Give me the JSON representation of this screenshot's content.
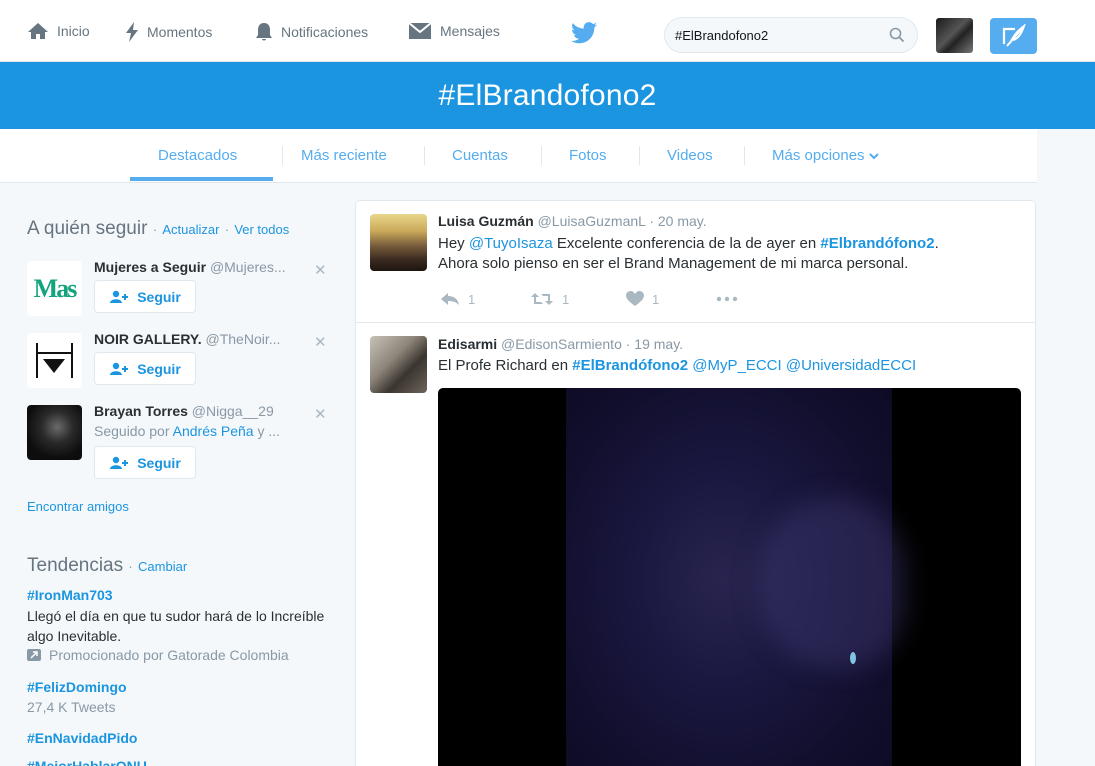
{
  "nav": {
    "home": "Inicio",
    "moments": "Momentos",
    "notifications": "Notificaciones",
    "messages": "Mensajes",
    "search_value": "#ElBrandofono2"
  },
  "banner": {
    "title": "#ElBrandofono2"
  },
  "tabs": [
    {
      "label": "Destacados",
      "active": true
    },
    {
      "label": "Más reciente"
    },
    {
      "label": "Cuentas"
    },
    {
      "label": "Fotos"
    },
    {
      "label": "Videos"
    },
    {
      "label": "Más opciones"
    }
  ],
  "who_to_follow": {
    "title": "A quién seguir",
    "refresh": "Actualizar",
    "view_all": "Ver todos",
    "follow_label": "Seguir",
    "accounts": [
      {
        "name": "Mujeres a Seguir",
        "handle": "@Mujeres...",
        "logo_text": "Mas"
      },
      {
        "name": "NOIR GALLERY.",
        "handle": "@TheNoir..."
      },
      {
        "name": "Brayan Torres",
        "handle": "@Nigga__29",
        "followed_by_prefix": "Seguido por",
        "followed_by": "Andrés Peña",
        "followed_by_suffix": "y ..."
      }
    ],
    "find_friends": "Encontrar amigos"
  },
  "trends": {
    "title": "Tendencias",
    "change": "Cambiar",
    "items": [
      {
        "tag": "#IronMan703",
        "text": "Llegó el día en que tu sudor hará de lo Increíble algo Inevitable.",
        "promoted": "Promocionado por Gatorade Colombia"
      },
      {
        "tag": "#FelizDomingo",
        "meta": "27,4 K Tweets"
      },
      {
        "tag": "#EnNavidadPido"
      },
      {
        "tag": "#MejorHablarONU"
      }
    ]
  },
  "tweets": [
    {
      "name": "Luisa Guzmán",
      "handle": "@LuisaGuzmanL",
      "date": "· 20 may.",
      "text_parts": [
        "Hey ",
        "@TuyoIsaza",
        " Excelente conferencia de la de ayer en ",
        "#Elbrandófono2",
        ".",
        "Ahora solo pienso en ser el Brand Management de mi marca personal."
      ],
      "replies": "1",
      "retweets": "1",
      "likes": "1"
    },
    {
      "name": "Edisarmi",
      "handle": "@EdisonSarmiento",
      "date": "· 19 may.",
      "text_parts": [
        "El Profe Richard en ",
        "#ElBrandófono2",
        " ",
        "@MyP_ECCI",
        " ",
        "@UniversidadECCI"
      ]
    }
  ],
  "colors": {
    "accent": "#1b95e0",
    "banner": "#1b95e0",
    "text_muted": "#8899a6"
  }
}
